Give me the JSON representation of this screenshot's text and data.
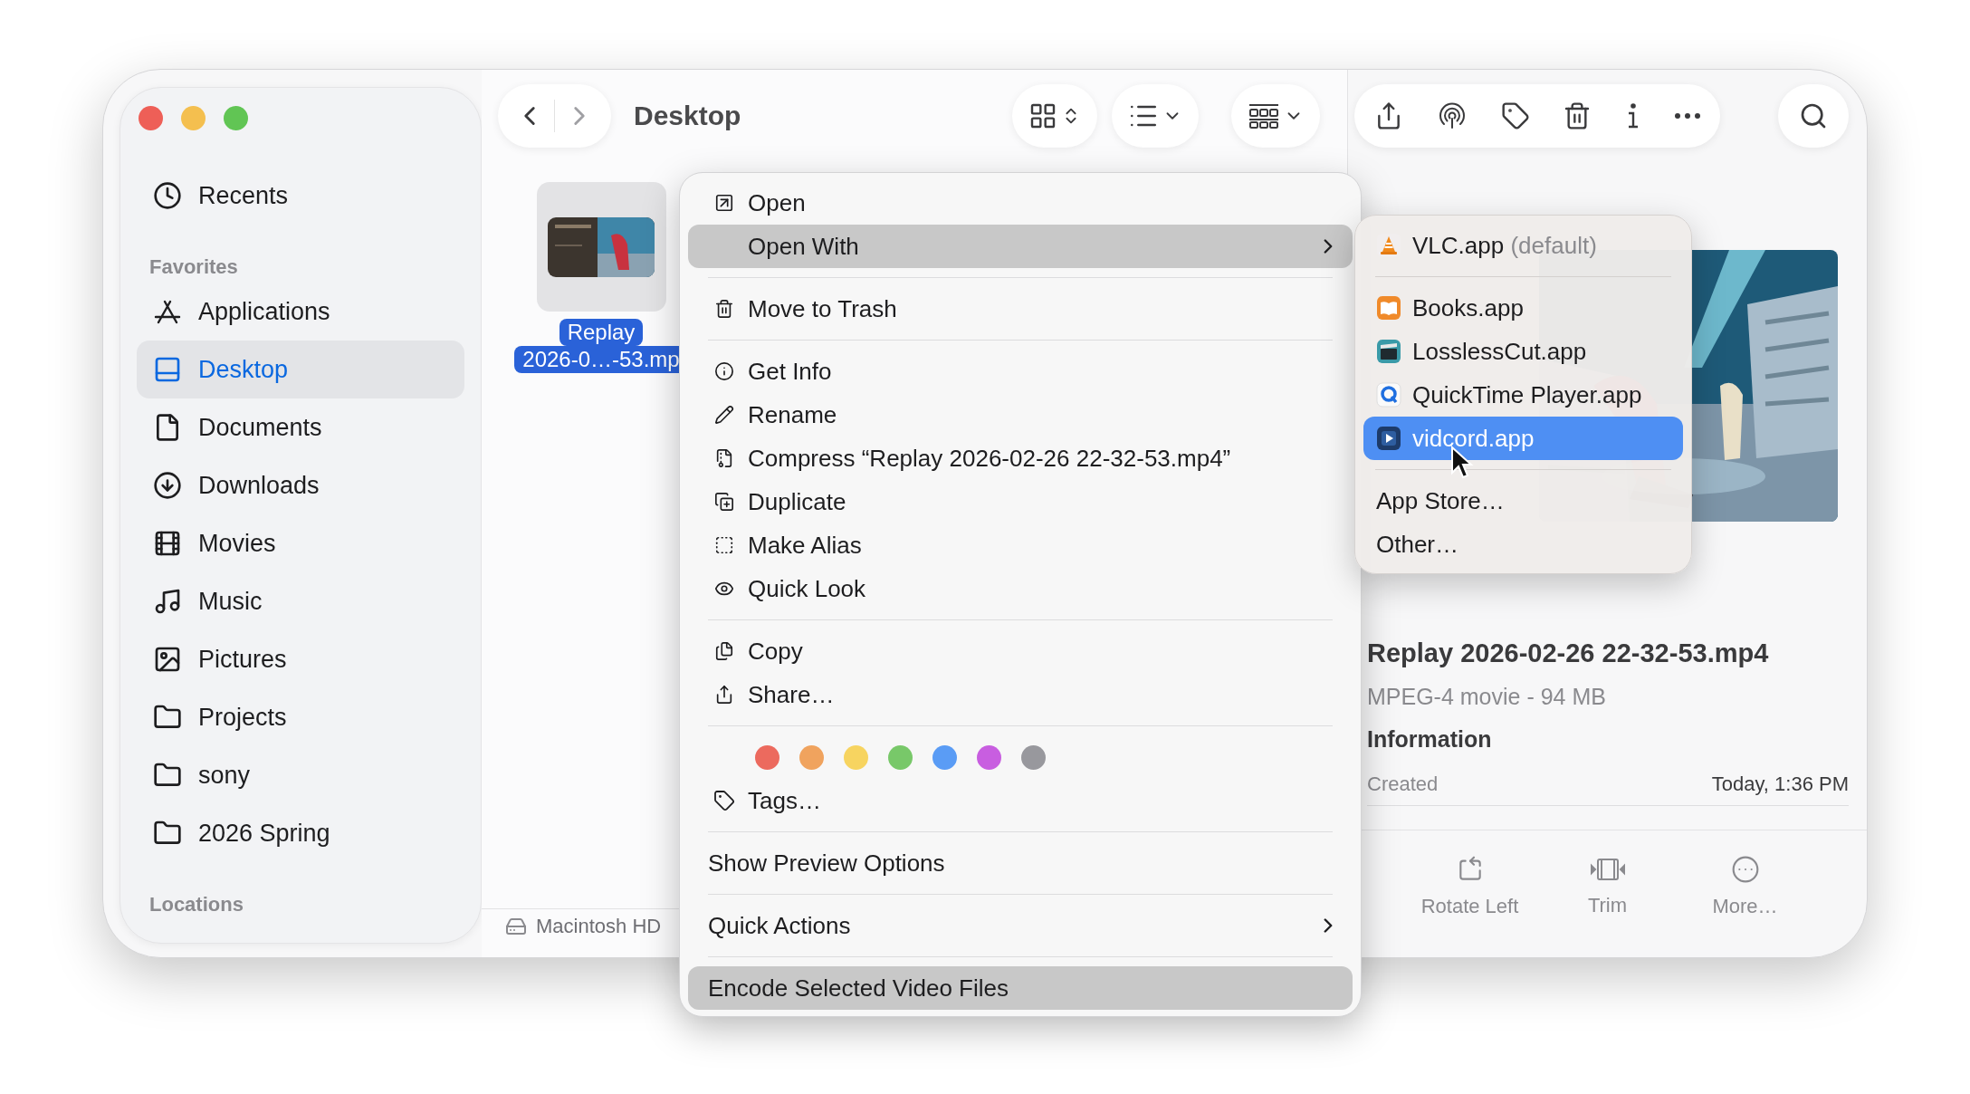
{
  "window": {
    "title": "Desktop"
  },
  "sidebar": {
    "sections": [
      {
        "items": [
          {
            "label": "Recents",
            "selected": false
          }
        ]
      },
      {
        "heading": "Favorites",
        "items": [
          {
            "label": "Applications",
            "selected": false
          },
          {
            "label": "Desktop",
            "selected": true
          },
          {
            "label": "Documents",
            "selected": false
          },
          {
            "label": "Downloads",
            "selected": false
          },
          {
            "label": "Movies",
            "selected": false
          },
          {
            "label": "Music",
            "selected": false
          },
          {
            "label": "Pictures",
            "selected": false
          },
          {
            "label": "Projects",
            "selected": false
          },
          {
            "label": "sony",
            "selected": false
          },
          {
            "label": "2026 Spring",
            "selected": false
          }
        ]
      },
      {
        "heading": "Locations"
      }
    ]
  },
  "files": [
    {
      "name_lines": [
        "Replay",
        "2026-0…-53.mp"
      ],
      "selected": true
    }
  ],
  "path_bar": [
    "Macintosh HD"
  ],
  "context_menu": {
    "sections": [
      {
        "kind": "items",
        "items": [
          {
            "label": "Open",
            "selected": false
          },
          {
            "label": "Open With",
            "selected": true,
            "submenu": true
          }
        ]
      },
      {
        "kind": "items",
        "items": [
          {
            "label": "Move to Trash",
            "selected": false
          }
        ]
      },
      {
        "kind": "items",
        "items": [
          {
            "label": "Get Info",
            "selected": false
          },
          {
            "label": "Rename",
            "selected": false
          },
          {
            "label": "Compress “Replay 2026-02-26 22-32-53.mp4”",
            "selected": false
          },
          {
            "label": "Duplicate",
            "selected": false
          },
          {
            "label": "Make Alias",
            "selected": false
          },
          {
            "label": "Quick Look",
            "selected": false
          }
        ]
      },
      {
        "kind": "items",
        "items": [
          {
            "label": "Copy",
            "selected": false
          },
          {
            "label": "Share…",
            "selected": false
          }
        ]
      },
      {
        "kind": "tags",
        "tags": [
          {
            "color": "#ec6a5e"
          },
          {
            "color": "#f0a35e"
          },
          {
            "color": "#f7d460"
          },
          {
            "color": "#78c869"
          },
          {
            "color": "#5a9cf5"
          },
          {
            "color": "#c85ee0"
          },
          {
            "color": "#98989d"
          }
        ],
        "label": "Tags…"
      },
      {
        "kind": "items",
        "items": [
          {
            "label": "Show Preview Options",
            "selected": false
          }
        ]
      },
      {
        "kind": "items",
        "items": [
          {
            "label": "Quick Actions",
            "selected": false,
            "submenu": true
          }
        ]
      },
      {
        "kind": "items",
        "items": [
          {
            "label": "Encode Selected Video Files",
            "selected": true
          }
        ]
      }
    ]
  },
  "open_with": {
    "sections": [
      [
        {
          "label": "VLC.app",
          "note": "(default)",
          "selected": false
        }
      ],
      [
        {
          "label": "Books.app",
          "selected": false
        },
        {
          "label": "LosslessCut.app",
          "selected": false
        },
        {
          "label": "QuickTime Player.app",
          "selected": false
        },
        {
          "label": "vidcord.app",
          "selected": true
        }
      ],
      [
        {
          "label": "App Store…",
          "selected": false
        },
        {
          "label": "Other…",
          "selected": false
        }
      ]
    ]
  },
  "preview": {
    "title": "Replay 2026-02-26 22-32-53.mp4",
    "subtitle": "MPEG-4 movie - 94 MB",
    "heading": "Information",
    "rows": [
      {
        "label": "Created",
        "value": "Today, 1:36 PM"
      }
    ],
    "actions": [
      "Rotate Left",
      "Trim",
      "More…"
    ]
  }
}
